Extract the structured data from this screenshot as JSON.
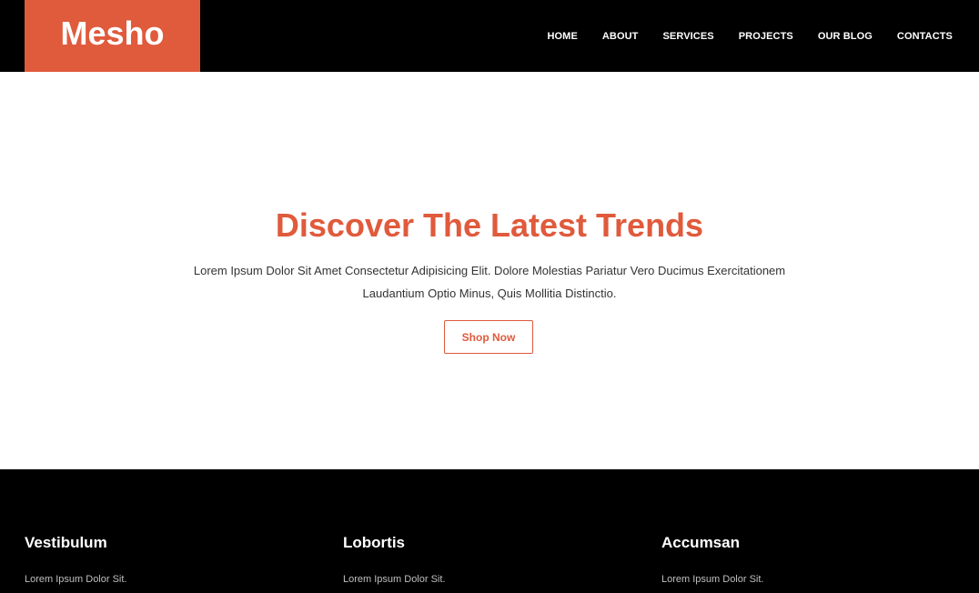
{
  "brand": {
    "logo_text": "Mesho",
    "accent_color": "#e05a3c"
  },
  "nav": {
    "items": [
      {
        "label": "HOME"
      },
      {
        "label": "ABOUT"
      },
      {
        "label": "SERVICES"
      },
      {
        "label": "PROJECTS"
      },
      {
        "label": "OUR BLOG"
      },
      {
        "label": "CONTACTS"
      }
    ]
  },
  "hero": {
    "title": "Discover The Latest Trends",
    "text": "Lorem Ipsum Dolor Sit Amet Consectetur Adipisicing Elit. Dolore Molestias Pariatur Vero Ducimus Exercitationem Laudantium Optio Minus, Quis Mollitia Distinctio.",
    "button_label": "Shop Now"
  },
  "footer": {
    "columns": [
      {
        "heading": "Vestibulum",
        "text": "Lorem Ipsum Dolor Sit."
      },
      {
        "heading": "Lobortis",
        "text": "Lorem Ipsum Dolor Sit."
      },
      {
        "heading": "Accumsan",
        "text": "Lorem Ipsum Dolor Sit."
      }
    ]
  }
}
